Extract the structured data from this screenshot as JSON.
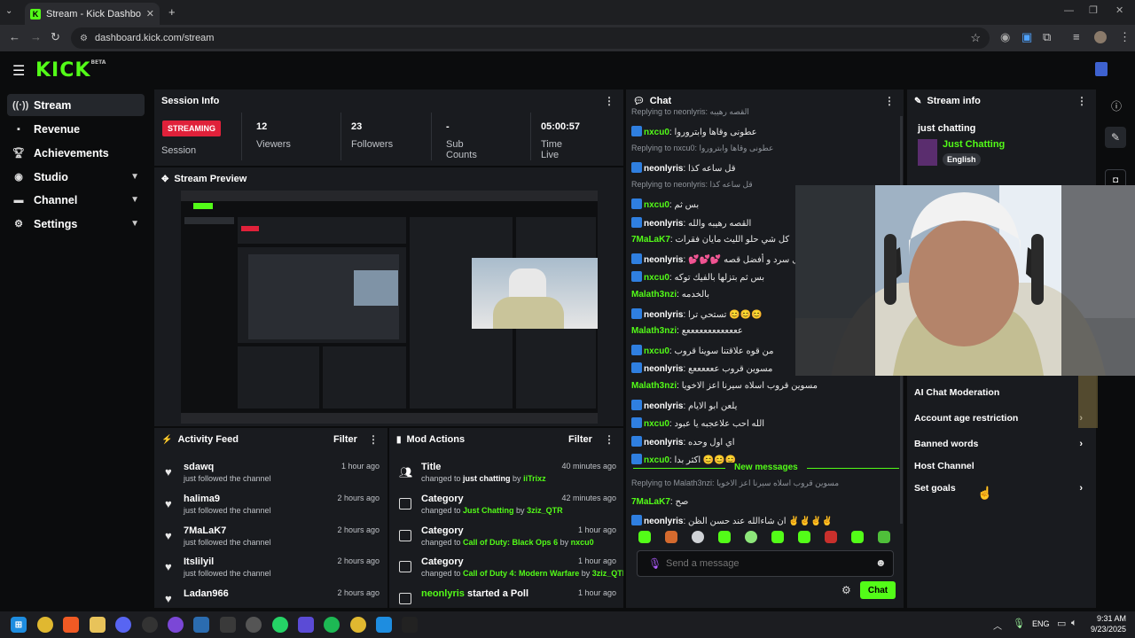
{
  "browser": {
    "tab_title": "Stream - Kick Dashboard",
    "url": "dashboard.kick.com/stream"
  },
  "header": {
    "logo": "KICK",
    "logo_badge": "BETA"
  },
  "sidebar": {
    "items": [
      {
        "label": "Stream",
        "icon": "broadcast-icon",
        "active": true
      },
      {
        "label": "Revenue",
        "icon": "revenue-icon"
      },
      {
        "label": "Achievements",
        "icon": "trophy-icon"
      },
      {
        "label": "Studio",
        "icon": "studio-icon",
        "expandable": true
      },
      {
        "label": "Channel",
        "icon": "channel-icon",
        "expandable": true
      },
      {
        "label": "Settings",
        "icon": "gear-icon",
        "expandable": true
      }
    ]
  },
  "session_info": {
    "title": "Session Info",
    "status_badge": "STREAMING",
    "session_label": "Session",
    "stats": [
      {
        "value": "12",
        "label": "Viewers"
      },
      {
        "value": "23",
        "label": "Followers"
      },
      {
        "value": "-",
        "label": "Sub Counts"
      },
      {
        "value": "05:00:57",
        "label": "Time Live"
      }
    ]
  },
  "stream_preview": {
    "title": "Stream Preview"
  },
  "activity_feed": {
    "title": "Activity Feed",
    "filter": "Filter",
    "items": [
      {
        "name": "sdawq",
        "text": "just followed the channel",
        "time": "1 hour ago"
      },
      {
        "name": "halima9",
        "text": "just followed the channel",
        "time": "2 hours ago"
      },
      {
        "name": "7MaLaK7",
        "text": "just followed the channel",
        "time": "2 hours ago"
      },
      {
        "name": "Itslilyil",
        "text": "just followed the channel",
        "time": "2 hours ago"
      },
      {
        "name": "Ladan966",
        "text": "",
        "time": "2 hours ago"
      }
    ]
  },
  "mod_actions": {
    "title": "Mod Actions",
    "filter": "Filter",
    "items": [
      {
        "title": "Title",
        "pre": "changed to ",
        "value": "just chatting",
        "mid": " by ",
        "by": "iiTrixz",
        "time": "40 minutes ago",
        "value_white": true
      },
      {
        "title": "Category",
        "pre": "changed to ",
        "value": "Just Chatting",
        "mid": " by ",
        "by": "3ziz_QTR",
        "time": "42 minutes ago"
      },
      {
        "title": "Category",
        "pre": "changed to ",
        "value": "Call of Duty: Black Ops 6",
        "mid": " by ",
        "by": "nxcu0",
        "time": "1 hour ago"
      },
      {
        "title": "Category",
        "pre": "changed to ",
        "value": "Call of Duty 4: Modern Warfare",
        "mid": " by ",
        "by": "3ziz_QTR",
        "time": "1 hour ago"
      },
      {
        "title": "neonlyris",
        "title_suffix": " started a Poll",
        "time": "1 hour ago",
        "title_green": true
      }
    ]
  },
  "chat": {
    "title": "Chat",
    "lines": [
      {
        "reply": "Replying to neonlyris: القصه رهيبه"
      },
      {
        "user": "nxcu0",
        "color": "#53fc18",
        "msg": "عطونى وقاها وابتروروا",
        "icon": true
      },
      {
        "reply": "Replying to nxcu0: عطونى وقاها وابتروروا"
      },
      {
        "user": "neonlyris",
        "color": "#ffffff",
        "msg": "قل ساعه كذا",
        "icon": true
      },
      {
        "reply": "Replying to neonlyris: قل ساعه كذا"
      },
      {
        "user": "nxcu0",
        "color": "#53fc18",
        "msg": "بس ثم",
        "icon": true
      },
      {
        "user": "neonlyris",
        "color": "#ffffff",
        "msg": "القصه رهيبه والله",
        "icon": true
      },
      {
        "user": "7MaLaK7",
        "color": "#53fc18",
        "msg": "كل شي حلو الليث مايان فقرات",
        "icon": false
      },
      {
        "user": "neonlyris",
        "color": "#ffffff",
        "msg": "💕💕💕 أفضل سرد و أفضل قصه",
        "icon": true
      },
      {
        "user": "nxcu0",
        "color": "#53fc18",
        "msg": "بس ثم بتزلها بالفيك توكه",
        "icon": true
      },
      {
        "user": "Malath3nzi",
        "color": "#53fc18",
        "msg": "بالخدمه",
        "icon": false
      },
      {
        "user": "neonlyris",
        "color": "#ffffff",
        "msg": "تستحي ترا 😊😊😊",
        "icon": true
      },
      {
        "user": "Malath3nzi",
        "color": "#53fc18",
        "msg": "عععععععععععععع",
        "icon": false
      },
      {
        "user": "nxcu0",
        "color": "#53fc18",
        "msg": "من قوه علاقتنا سوينا قروب",
        "icon": true
      },
      {
        "user": "neonlyris",
        "color": "#ffffff",
        "msg": "مسوين قروب ععععععع",
        "icon": true
      },
      {
        "user": "Malath3nzi",
        "color": "#53fc18",
        "msg": "مسوين قروب اسلاه سيرنا اعز الاخويا",
        "icon": false
      },
      {
        "user": "neonlyris",
        "color": "#ffffff",
        "msg": "يلعن ابو الايام",
        "icon": true
      },
      {
        "user": "nxcu0",
        "color": "#53fc18",
        "msg": "الله احب علاعجبه يا عبود",
        "icon": true
      },
      {
        "user": "neonlyris",
        "color": "#ffffff",
        "msg": "اي اول وحده",
        "icon": true
      },
      {
        "user": "nxcu0",
        "color": "#53fc18",
        "msg": "اكثر بدا 😊😊😊",
        "icon": true
      }
    ],
    "new_messages": "New messages",
    "after": [
      {
        "reply": "Replying to Malath3nzi: مسوين قروب اسلاه سيرنا اعز الاخويا"
      },
      {
        "user": "7MaLaK7",
        "color": "#53fc18",
        "msg": "صح",
        "icon": false
      },
      {
        "user": "neonlyris",
        "color": "#ffffff",
        "msg": "ان شاءالله عند حسن الظن ✌✌✌✌",
        "icon": true
      }
    ],
    "input_placeholder": "Send a message",
    "send_label": "Chat"
  },
  "stream_info": {
    "title": "Stream info",
    "stream_title": "just chatting",
    "category": "Just Chatting",
    "language": "English",
    "items": [
      {
        "label": "AI Chat Moderation",
        "chevron": false
      },
      {
        "label": "Account age restriction",
        "chevron": true
      },
      {
        "label": "Banned words",
        "chevron": true
      },
      {
        "label": "Host Channel",
        "chevron": false
      },
      {
        "label": "Set goals",
        "chevron": true
      }
    ]
  },
  "taskbar": {
    "lang": "ENG",
    "time": "9:31 AM",
    "date": "9/23/2025"
  },
  "colors": {
    "accent": "#53fc18",
    "live": "#e0213a",
    "panel": "#191b1f"
  }
}
